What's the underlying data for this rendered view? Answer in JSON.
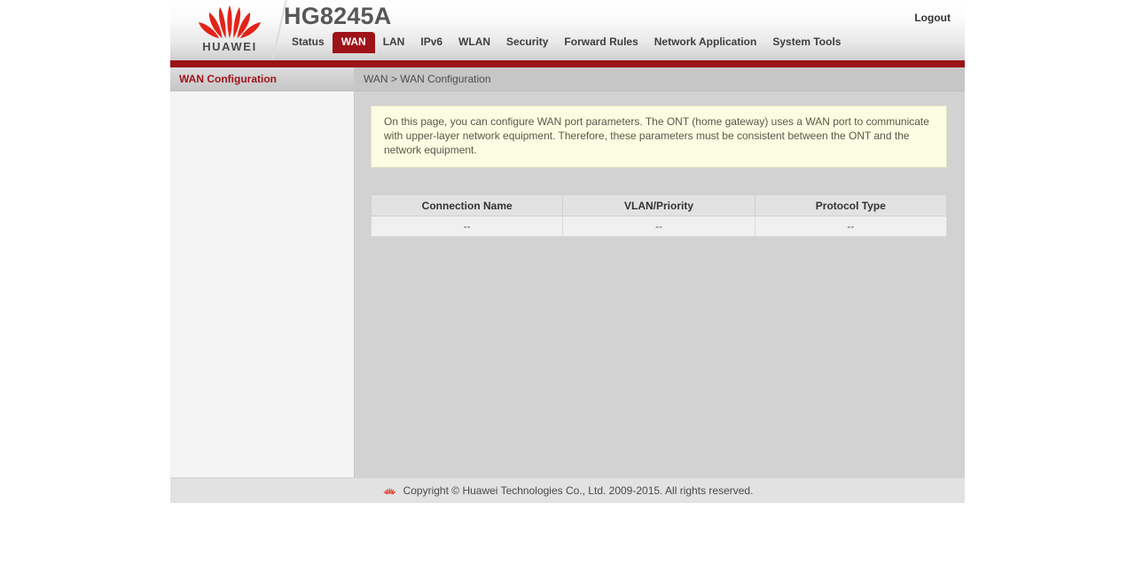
{
  "header": {
    "brand_word": "HUAWEI",
    "model_title": "HG8245A",
    "logout_label": "Logout",
    "brand_red": "#e2231a",
    "nav_bar_red": "#9a1318"
  },
  "nav": {
    "items": [
      {
        "label": "Status",
        "active": false
      },
      {
        "label": "WAN",
        "active": true
      },
      {
        "label": "LAN",
        "active": false
      },
      {
        "label": "IPv6",
        "active": false
      },
      {
        "label": "WLAN",
        "active": false
      },
      {
        "label": "Security",
        "active": false
      },
      {
        "label": "Forward Rules",
        "active": false
      },
      {
        "label": "Network Application",
        "active": false
      },
      {
        "label": "System Tools",
        "active": false
      }
    ]
  },
  "sidebar": {
    "items": [
      {
        "label": "WAN Configuration",
        "selected": true
      }
    ]
  },
  "main": {
    "breadcrumb": "WAN > WAN Configuration",
    "notice": "On this page, you can configure WAN port parameters. The ONT (home gateway) uses a WAN port to communicate with upper-layer network equipment. Therefore, these parameters must be consistent between the ONT and the network equipment.",
    "table": {
      "headers": [
        "Connection Name",
        "VLAN/Priority",
        "Protocol Type"
      ],
      "rows": [
        [
          "--",
          "--",
          "--"
        ]
      ]
    }
  },
  "footer": {
    "copyright": "Copyright © Huawei Technologies Co., Ltd. 2009-2015. All rights reserved."
  }
}
